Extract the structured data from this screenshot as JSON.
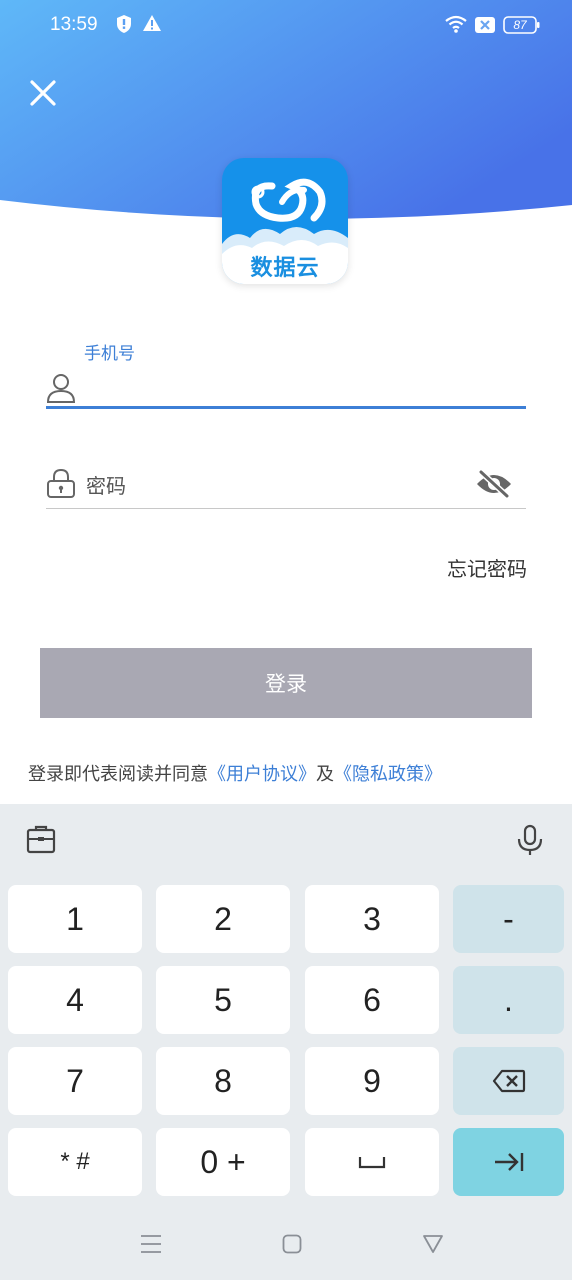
{
  "status_bar": {
    "time": "13:59",
    "battery": "87",
    "icons": [
      "shield-icon",
      "warning-icon",
      "wifi-icon",
      "sim-off-icon",
      "battery-icon"
    ]
  },
  "header": {
    "close_icon": "close-icon",
    "logo_text": "数据云",
    "gradient_colors": [
      "#5eb7f7",
      "#4a78e9"
    ]
  },
  "form": {
    "phone_label": "手机号",
    "phone_value": "",
    "password_placeholder": "密码",
    "forgot_password": "忘记密码",
    "login_button": "登录"
  },
  "agreement": {
    "prefix": "登录即代表阅读并同意",
    "user_agreement": "《用户协议》",
    "conjunction": "及",
    "privacy_policy": "《隐私政策》"
  },
  "keyboard": {
    "rows": [
      [
        "1",
        "2",
        "3",
        "-"
      ],
      [
        "4",
        "5",
        "6",
        "."
      ],
      [
        "7",
        "8",
        "9",
        "backspace"
      ],
      [
        "* #",
        "0 +",
        "space",
        "next"
      ]
    ]
  },
  "colors": {
    "accent": "#3d7fd6",
    "button_disabled": "#a9a8b3",
    "keyboard_bg": "#e8ecef",
    "enter_key": "#7fd3e2"
  }
}
